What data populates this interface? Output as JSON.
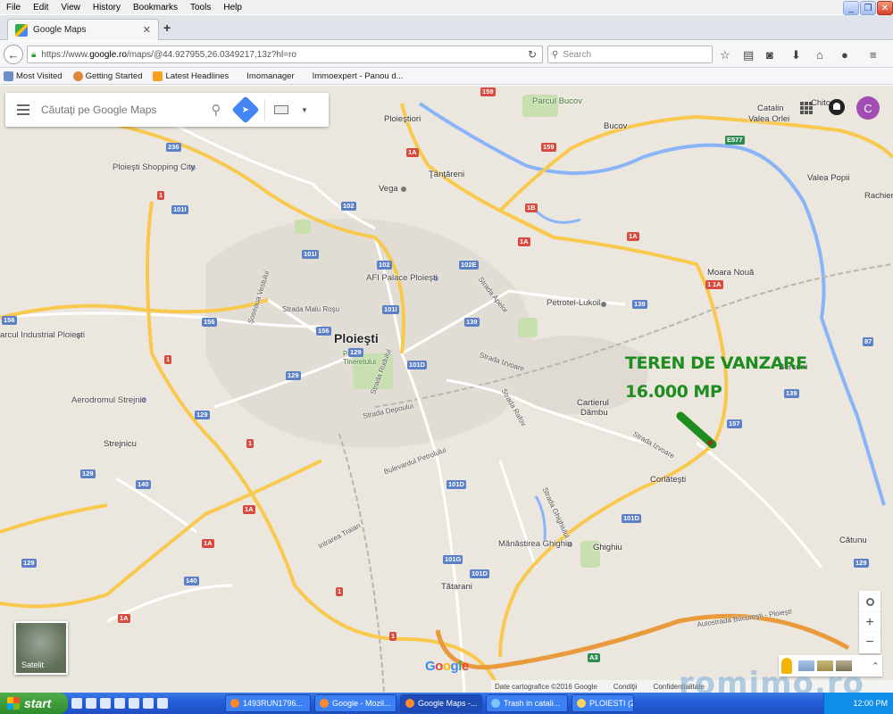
{
  "window": {
    "menu": [
      "File",
      "Edit",
      "View",
      "History",
      "Bookmarks",
      "Tools",
      "Help"
    ]
  },
  "tab": {
    "title": "Google Maps"
  },
  "browser": {
    "url_prefix": "https://www.",
    "url_host": "google.ro",
    "url_rest": "/maps/@44.927955,26.0349217,13z?hl=ro",
    "search_placeholder": "Search"
  },
  "bookmarks": [
    "Most Visited",
    "Getting Started",
    "Latest Headlines",
    "Imomanager",
    "Immoexpert - Panou d..."
  ],
  "maps": {
    "search_placeholder": "Căutaţi pe Google Maps",
    "account_initial": "C",
    "satellite_label": "Satelit",
    "footer": [
      "Date cartografice ©2016 Google",
      "Condiţii",
      "Confidentialitate"
    ],
    "watermark": "romimo.ro"
  },
  "annotation": {
    "title": "TEREN DE VANZARE",
    "area": "16.000 MP",
    "color": "#1f8c1f"
  },
  "places": {
    "city": "Ploieşti",
    "ploiestiori": "Ploieştiori",
    "parcul_bucov": "Parcul Bucov",
    "bucov": "Bucov",
    "catalin": "Catalin",
    "valea_orlei": "Valea Orlei",
    "chitorani": "Chitor...",
    "valea_popii": "Valea Popii",
    "rachieri": "Rachier",
    "tantareni": "Ţânţăreni",
    "vega": "Vega",
    "shopping": "Ploieşti Shopping City",
    "afi": "AFI Palace Ploieşti",
    "moara_noua": "Moara Nouă",
    "petrotel": "Petrotel-Lukoil",
    "parc_industrial": "arcul Industrial Ploieşti",
    "berceni": "Berceni",
    "aerodrom": "Aerodromul Strejnic",
    "cartierul": "Cartierul",
    "dambu": "Dâmbu",
    "strejnicu": "Strejnicu",
    "corlatesti": "Corlăteşti",
    "manastirea": "Mănăstirea Ghighiu",
    "ghighiu": "Ghighiu",
    "catunu": "Cătunu",
    "tatarani": "Tătarani",
    "parcul_tineretului": "Parcul Tineretului"
  },
  "streets": {
    "malu_rosu": "Strada Malu Roşu",
    "soseaua_vestului": "Şoseaua Vestului",
    "apelor": "Strada Apelor",
    "izvoare": "Strada Izvoare",
    "rudului": "Strada Rudului",
    "depoului": "Strada Depoului",
    "rafov": "Strada Rafov",
    "bd_petrolului": "Bulevardul Petrolului",
    "izvoare2": "Strada Izvoare",
    "ghighiului": "Strada Ghighiului",
    "intrarea_traian": "Intrarea Traian",
    "autostrada": "Autostrada Bucureşti - Ploieşti"
  },
  "shields": {
    "s159a": "159",
    "s159b": "159",
    "s236": "236",
    "s1a": "1",
    "s101i": "101I",
    "s102": "102",
    "s102b": "102",
    "s102e": "102E",
    "s101ia": "101I",
    "s101ib": "101I",
    "s156a": "156",
    "s156b": "156",
    "s139a": "139",
    "s139b": "139",
    "s129a": "129",
    "s129b": "129",
    "s129c": "129",
    "s101d": "101D",
    "s101da": "101D",
    "s101g": "101G",
    "s101db": "101D",
    "s1b": "1",
    "s140a": "140",
    "s140b": "140",
    "s1ab": "1A",
    "s1ac": "1A",
    "s1ad": "1A",
    "s1ae": "1A",
    "s1ba": "1B",
    "s1ag": "1A",
    "s157": "157",
    "s1f": "1",
    "s1g": "1",
    "s1h": "1",
    "s139c": "139",
    "s129d": "129",
    "s129e": "129",
    "se577": "E577",
    "s1ah": "1A",
    "s87": "87",
    "s1i": "1",
    "sa3": "A3"
  },
  "taskbar": {
    "start": "start",
    "tasks": [
      "1493RUN1796...",
      "Google - Mozil...",
      "Google Maps -...",
      "Trash in catali...",
      "PLOIESTI (2)"
    ],
    "clock": "12:00 PM"
  },
  "colors": {
    "map_bg": "#ebe7df",
    "major_road": "#f9c94e",
    "minor_road": "#ffffff",
    "motorway": "#e89a3c",
    "river": "#8ab4f8",
    "park": "#c8dfb0",
    "urban": "#e1ddd5"
  }
}
